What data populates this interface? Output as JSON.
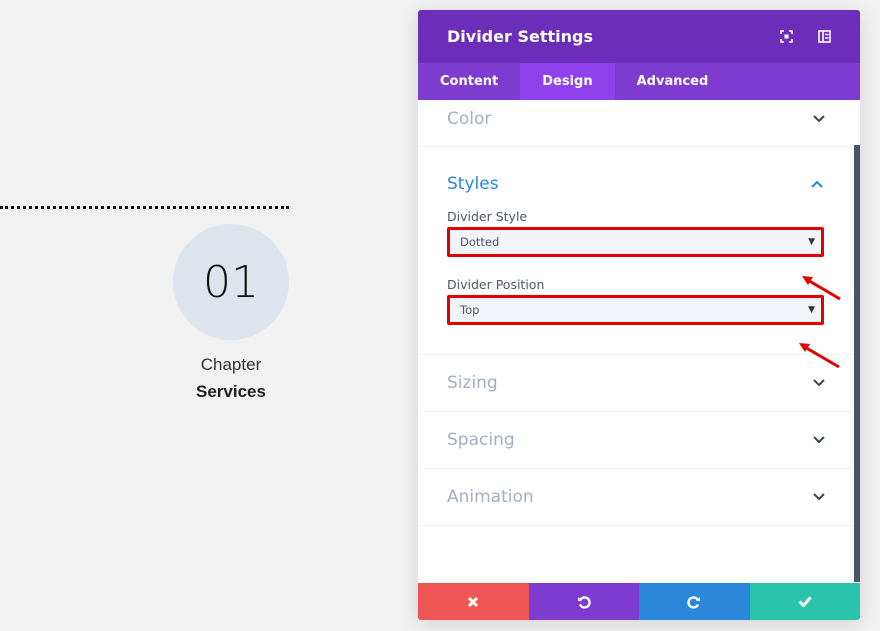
{
  "preview": {
    "number": "01",
    "chapter": "Chapter",
    "title": "Services"
  },
  "panel": {
    "title": "Divider Settings",
    "header_icons": [
      "fullscreen-icon",
      "sidebar-layout-icon"
    ],
    "tabs": [
      {
        "label": "Content",
        "active": false
      },
      {
        "label": "Design",
        "active": true
      },
      {
        "label": "Advanced",
        "active": false
      }
    ],
    "sections": {
      "color": "Color",
      "styles": "Styles",
      "sizing": "Sizing",
      "spacing": "Spacing",
      "animation": "Animation"
    },
    "fields": {
      "divider_style": {
        "label": "Divider Style",
        "value": "Dotted"
      },
      "divider_position": {
        "label": "Divider Position",
        "value": "Top"
      }
    },
    "footer_buttons": [
      {
        "name": "discard",
        "icon": "close-icon",
        "color": "#ef5555"
      },
      {
        "name": "undo",
        "icon": "undo-icon",
        "color": "#7e3bd0"
      },
      {
        "name": "redo",
        "icon": "redo-icon",
        "color": "#2b87da"
      },
      {
        "name": "save",
        "icon": "check-icon",
        "color": "#29c4a9"
      }
    ]
  },
  "colors": {
    "header": "#6c2eb9",
    "tabs": "#7e3bd0",
    "tab_active": "#8f42ec",
    "accent_blue": "#2b87da",
    "highlight_red": "#e30000"
  }
}
